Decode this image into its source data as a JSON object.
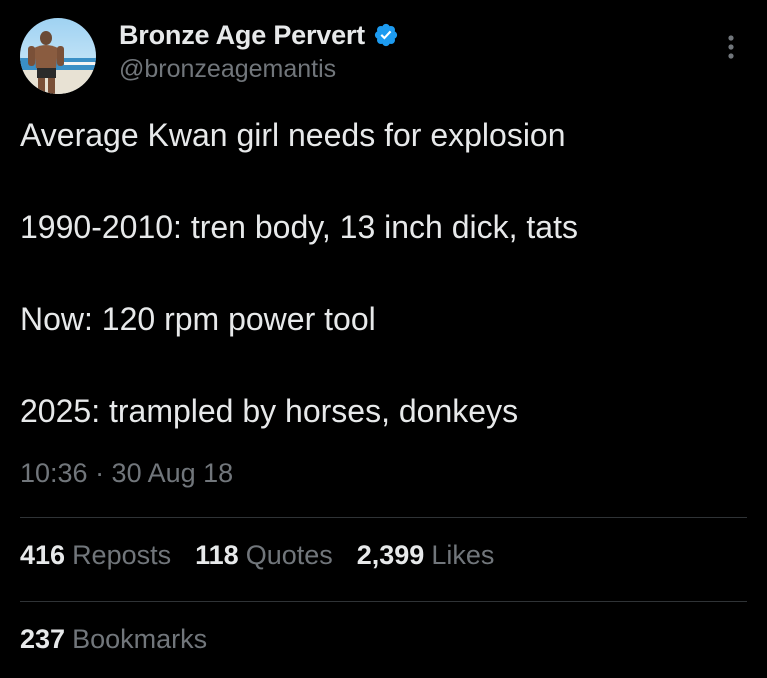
{
  "author": {
    "display_name": "Bronze Age Pervert",
    "handle": "@bronzeagemantis",
    "verified": true,
    "avatar_icon": "profile-photo-shirtless-man-at-beach"
  },
  "menu": {
    "icon": "more-vertical-icon"
  },
  "tweet": {
    "lines": [
      "Average Kwan girl needs for explosion",
      "1990-2010: tren body, 13 inch dick, tats",
      "Now: 120 rpm power tool",
      "2025: trampled by horses, donkeys"
    ],
    "timestamp": "10:36 · 30 Aug 18"
  },
  "stats": {
    "reposts": {
      "count": "416",
      "label": "Reposts"
    },
    "quotes": {
      "count": "118",
      "label": "Quotes"
    },
    "likes": {
      "count": "2,399",
      "label": "Likes"
    },
    "bookmarks": {
      "count": "237",
      "label": "Bookmarks"
    }
  },
  "colors": {
    "background": "#000000",
    "primary_text": "#e7e9ea",
    "secondary_text": "#71767b",
    "verified_blue": "#1d9bf0",
    "divider": "#2f3336"
  }
}
